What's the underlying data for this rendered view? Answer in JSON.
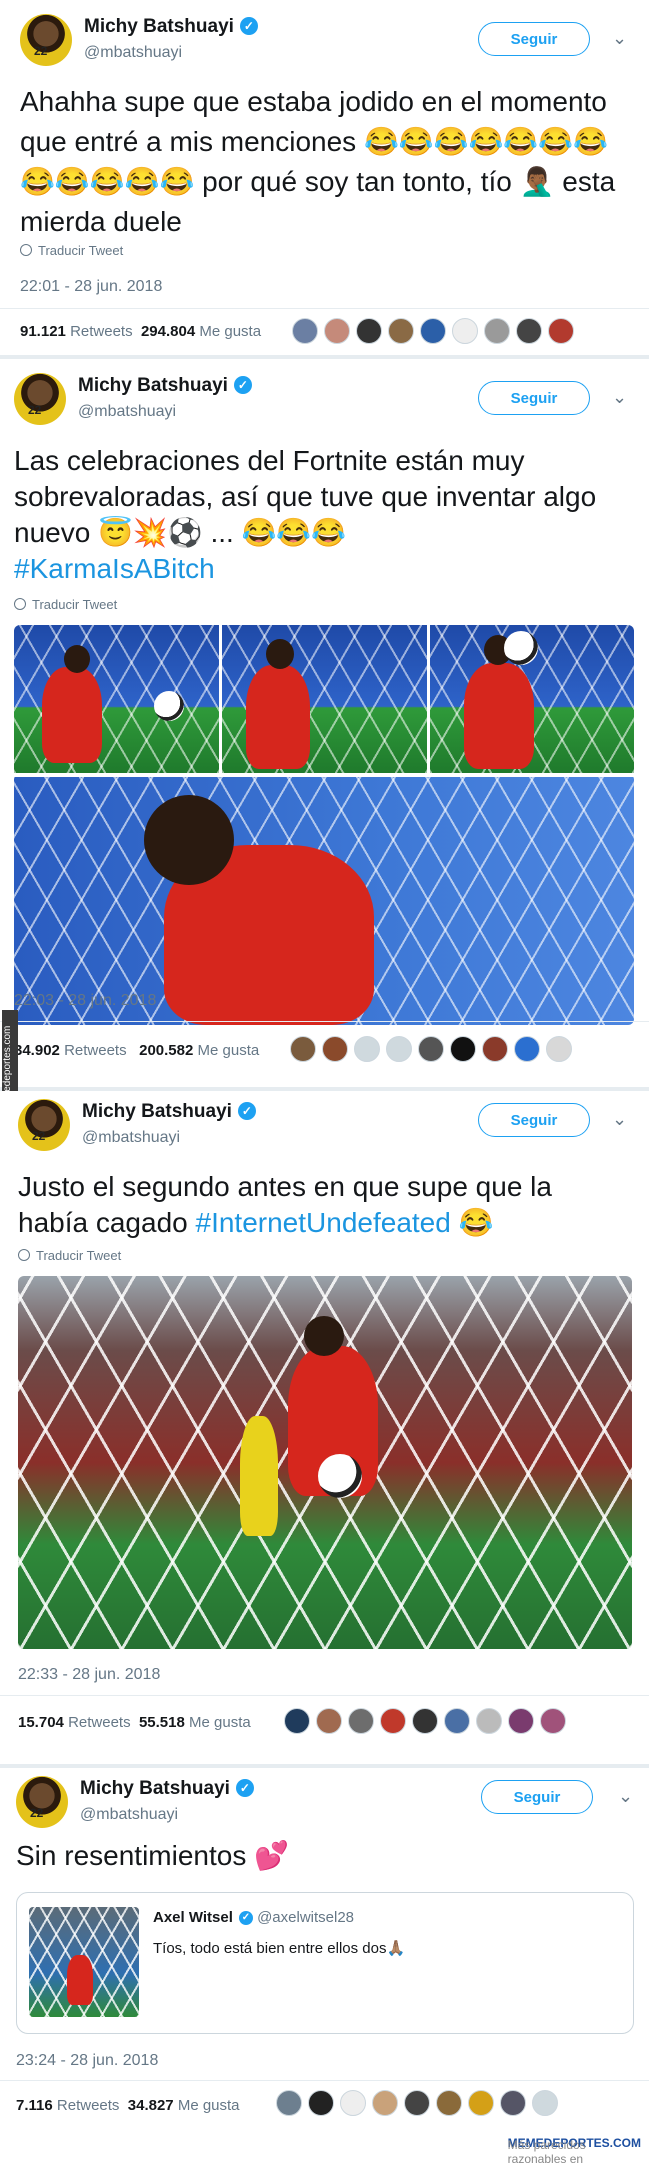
{
  "tweets": [
    {
      "name": "Michy Batshuayi",
      "handle": "@mbatshuayi",
      "follow_label": "Seguir",
      "text": "Ahahha supe que estaba jodido en el momento que entré a mis menciones 😂😂😂😂😂😂😂😂😂😂😂😂 por qué soy tan tonto, tío 🤦🏾‍♂️ esta mierda duele",
      "translate_label": "Traducir Tweet",
      "timestamp": "22:01 - 28 jun. 2018",
      "retweets": "91.121",
      "retweets_label": "Retweets",
      "likes": "294.804",
      "likes_label": "Me gusta"
    },
    {
      "name": "Michy Batshuayi",
      "handle": "@mbatshuayi",
      "follow_label": "Seguir",
      "text": "Las celebraciones del Fortnite están muy sobrevaloradas, así que tuve que inventar algo nuevo 😇💥⚽️ ... 😂😂😂",
      "hashtag": "#KarmaIsABitch",
      "translate_label": "Traducir Tweet",
      "timestamp": "22:03 - 28 jun. 2018",
      "retweets": "34.902",
      "retweets_label": "Retweets",
      "likes": "200.582",
      "likes_label": "Me gusta"
    },
    {
      "name": "Michy Batshuayi",
      "handle": "@mbatshuayi",
      "follow_label": "Seguir",
      "text": "Justo el segundo antes en que supe que la había cagado",
      "hashtag": "#InternetUndefeated",
      "text_suffix": "😂",
      "translate_label": "Traducir Tweet",
      "timestamp": "22:33 - 28 jun. 2018",
      "retweets": "15.704",
      "retweets_label": "Retweets",
      "likes": "55.518",
      "likes_label": "Me gusta"
    },
    {
      "name": "Michy Batshuayi",
      "handle": "@mbatshuayi",
      "follow_label": "Seguir",
      "text": "Sin resentimientos 💕",
      "quote_name": "Axel Witsel",
      "quote_handle": "@axelwitsel28",
      "quote_text": "Tíos, todo está bien entre ellos dos🙏🏽",
      "timestamp": "23:24 - 28 jun. 2018",
      "retweets": "7.116",
      "retweets_label": "Retweets",
      "likes": "34.827",
      "likes_label": "Me gusta"
    }
  ],
  "watermark": "Memedeportes.com",
  "footer": {
    "prefix": "Más parecidos razonables en",
    "brand": "MEMEDEPORTES.COM"
  },
  "colors": {
    "accent": "#1da1f2",
    "hashtag": "#1b95e0",
    "muted": "#657786",
    "belgium_red": "#d6261d"
  }
}
